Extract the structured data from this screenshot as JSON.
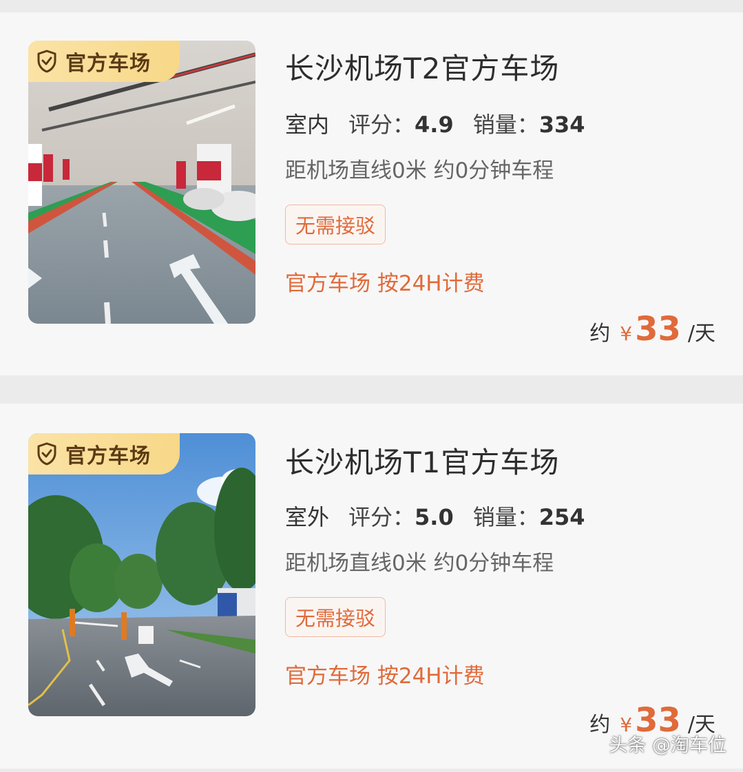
{
  "listings": [
    {
      "badge": "官方车场",
      "title": "长沙机场T2官方车场",
      "type": "室内",
      "rating_label": "评分：",
      "rating": "4.9",
      "sales_label": "销量：",
      "sales": "334",
      "distance": "距机场直线0米 约0分钟车程",
      "tag": "无需接驳",
      "policy": "官方车场 按24H计费",
      "price_prefix": "约",
      "currency": "¥",
      "price": "33",
      "price_unit": "/天",
      "image_icon": "indoor-garage-photo"
    },
    {
      "badge": "官方车场",
      "title": "长沙机场T1官方车场",
      "type": "室外",
      "rating_label": "评分：",
      "rating": "5.0",
      "sales_label": "销量：",
      "sales": "254",
      "distance": "距机场直线0米 约0分钟车程",
      "tag": "无需接驳",
      "policy": "官方车场 按24H计费",
      "price_prefix": "约",
      "currency": "¥",
      "price": "33",
      "price_unit": "/天",
      "image_icon": "outdoor-lot-photo"
    }
  ],
  "watermark": "头条 @淘车位",
  "colors": {
    "accent": "#e06a3a",
    "badge_bg": "#f8d888",
    "type_highlight": "#66d398"
  }
}
